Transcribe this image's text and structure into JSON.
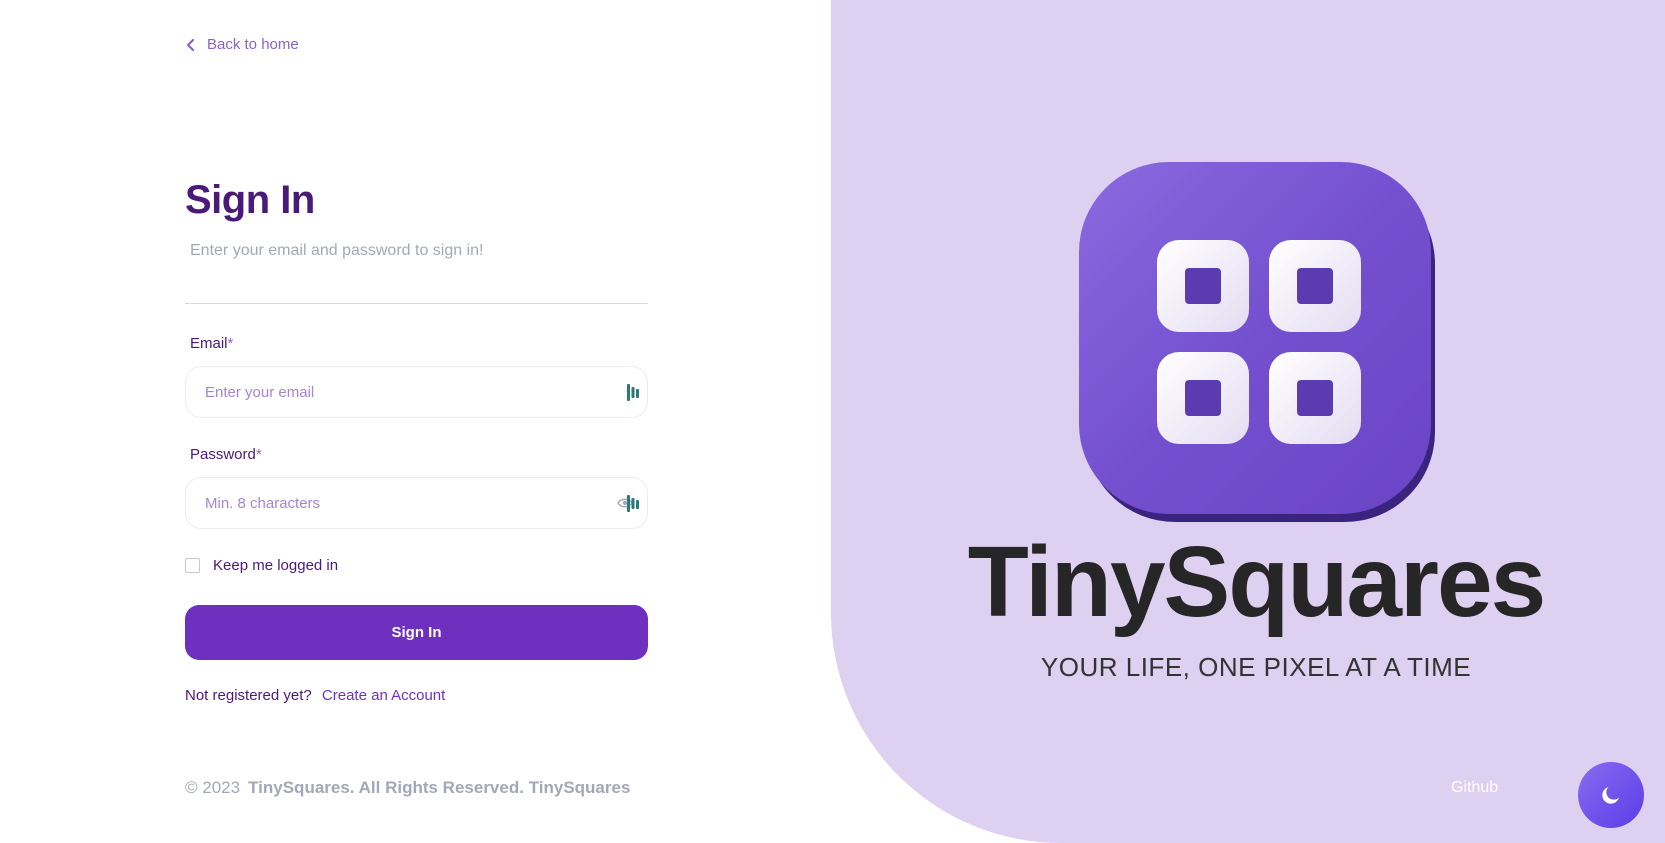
{
  "nav": {
    "back_label": "Back to home"
  },
  "signin": {
    "title": "Sign In",
    "subtitle": "Enter your email and password to sign in!",
    "email_label": "Email",
    "email_placeholder": "Enter your email",
    "password_label": "Password",
    "password_placeholder": "Min. 8 characters",
    "required_marker": "*",
    "keep_logged_label": "Keep me logged in",
    "keep_logged_checked": false,
    "submit_label": "Sign In",
    "register_prompt": "Not registered yet?",
    "register_link": "Create an Account"
  },
  "footer": {
    "copyright_year": "© 2023",
    "copyright_text": "TinySquares. All Rights Reserved.",
    "brand": "TinySquares"
  },
  "brand_panel": {
    "name": "TinySquares",
    "tagline": "YOUR LIFE, ONE PIXEL AT A TIME",
    "github_label": "Github",
    "logo_icon": "four-squares-app-icon"
  },
  "theme_toggle": {
    "icon": "moon-icon"
  },
  "colors": {
    "accent": "#7030bf",
    "heading": "#4a1a78",
    "muted": "#a3a8b8",
    "panel_bg": "#ddd0f0",
    "logo_purple": "#7a55d6",
    "toggle": "#6a4ef0"
  }
}
